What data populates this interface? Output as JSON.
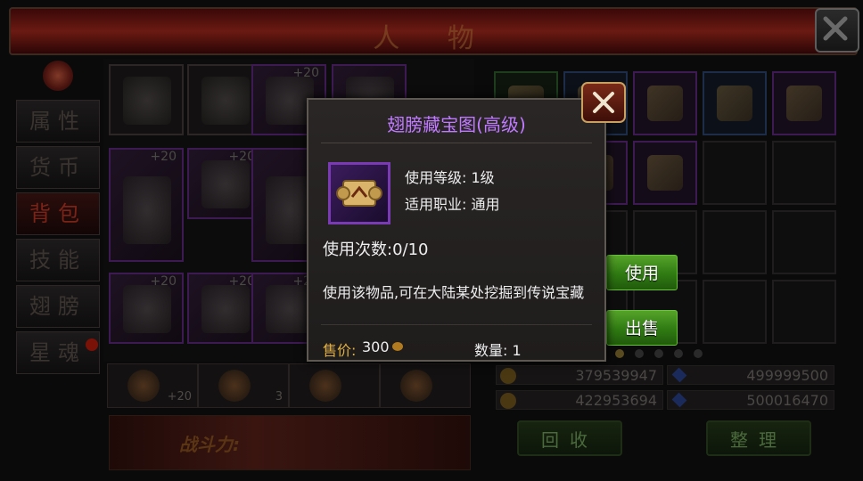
{
  "window": {
    "title": "人  物"
  },
  "sidebar": {
    "tabs": [
      {
        "label": "属性"
      },
      {
        "label": "货币"
      },
      {
        "label": "背包",
        "active": true
      },
      {
        "label": "技能"
      },
      {
        "label": "翅膀"
      },
      {
        "label": "星魂"
      }
    ]
  },
  "equipment": {
    "plus_labels": [
      "+20",
      "+20",
      "+20",
      "+20",
      "+20",
      "+20"
    ],
    "bottom_slots": [
      {
        "value": "+20"
      },
      {
        "value": "3"
      },
      {
        "value": ""
      },
      {
        "value": ""
      }
    ],
    "power_label": "战斗力:"
  },
  "currency": {
    "gold_1": "379539947",
    "diamond_1": "499999500",
    "gold_2": "422953694",
    "diamond_2": "500016470"
  },
  "buttons": {
    "recycle": "回收",
    "sort": "整理",
    "use": "使用",
    "sell": "出售"
  },
  "tooltip": {
    "item_name": "翅膀藏宝图(高级)",
    "item_name_color": "#c07aff",
    "level_line": "使用等级: 1级",
    "class_line": "适用职业: 通用",
    "uses_line": "使用次数:0/10",
    "description": "使用该物品,可在大陆某处挖掘到传说宝藏",
    "price_label": "售价:",
    "price_value": "300",
    "quantity": "数量: 1"
  },
  "icons": {
    "close": "close-icon",
    "scroll": "treasure-map-icon",
    "coin": "gold-coin-icon",
    "gem": "diamond-icon"
  }
}
